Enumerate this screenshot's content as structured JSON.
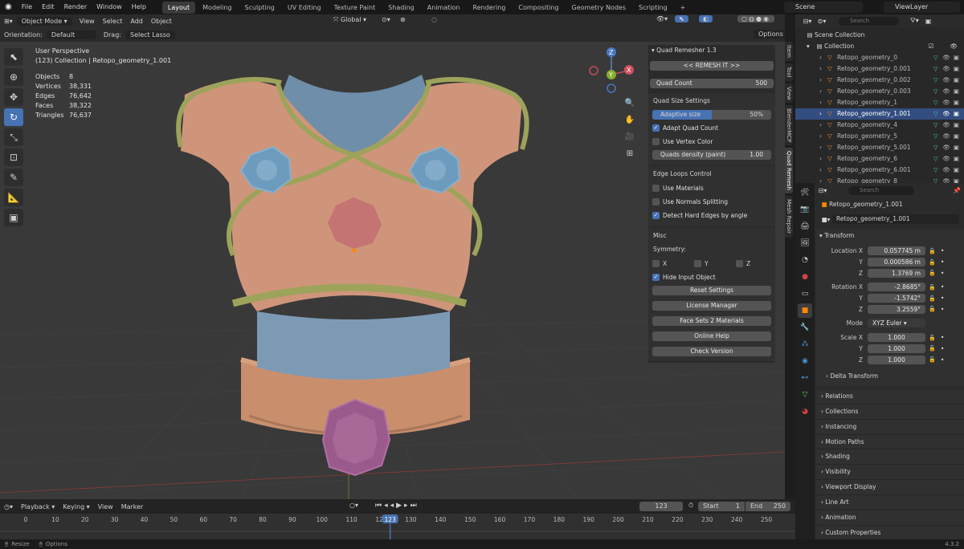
{
  "topbar": {
    "menus": [
      "File",
      "Edit",
      "Render",
      "Window",
      "Help"
    ],
    "workspaces": [
      "Layout",
      "Modeling",
      "Sculpting",
      "UV Editing",
      "Texture Paint",
      "Shading",
      "Animation",
      "Rendering",
      "Compositing",
      "Geometry Nodes",
      "Scripting"
    ],
    "active_workspace": "Layout",
    "add_tab": "+",
    "scene": "Scene",
    "view_layer": "ViewLayer"
  },
  "viewport": {
    "mode": "Object Mode",
    "menus": [
      "View",
      "Select",
      "Add",
      "Object"
    ],
    "orientation_label": "Orientation:",
    "orientation_value": "Default",
    "drag_label": "Drag:",
    "drag_value": "Select Lasso",
    "transform_orientation": "Global",
    "options": "Options",
    "view_name": "User Perspective",
    "collection_line": "(123) Collection | Retopo_geometry_1.001",
    "stats": [
      {
        "k": "Objects",
        "v": "8"
      },
      {
        "k": "Vertices",
        "v": "38,331"
      },
      {
        "k": "Edges",
        "v": "76,642"
      },
      {
        "k": "Faces",
        "v": "38,322"
      },
      {
        "k": "Triangles",
        "v": "76,637"
      }
    ],
    "gizmo": {
      "x": "X",
      "y": "Y",
      "z": "Z"
    }
  },
  "npanel": {
    "title": "Quad Remesher 1.3",
    "remesh_btn": "<<  REMESH IT >>",
    "quad_count_label": "Quad Count",
    "quad_count_value": "500",
    "quad_size_title": "Quad Size Settings",
    "adaptive_label": "Adaptive size",
    "adaptive_value": "50%",
    "adaptive_fill": 0.5,
    "adapt_quad_count": "Adapt Quad Count",
    "use_vertex_color": "Use Vertex Color",
    "quads_density_label": "Quads density (paint)",
    "quads_density_value": "1.00",
    "edge_loops_title": "Edge Loops Control",
    "use_materials": "Use Materials",
    "use_normals": "Use Normals Splitting",
    "detect_hard": "Detect Hard Edges by angle",
    "misc_title": "Misc",
    "symmetry_label": "Symmetry:",
    "sym_x": "X",
    "sym_y": "Y",
    "sym_z": "Z",
    "hide_input": "Hide Input Object",
    "reset_settings": "Reset Settings",
    "license_manager": "License Manager",
    "face_sets": "Face Sets 2 Materials",
    "online_help": "Online Help",
    "check_version": "Check Version"
  },
  "vtabs": [
    "Item",
    "Tool",
    "View",
    "BlenderMCP",
    "Quad Remesh",
    "Mesh Repair"
  ],
  "outliner": {
    "search_placeholder": "Search",
    "scene_collection": "Scene Collection",
    "collection": "Collection",
    "items": [
      "Retopo_geometry_0",
      "Retopo_geometry_0.001",
      "Retopo_geometry_0.002",
      "Retopo_geometry_0.003",
      "Retopo_geometry_1",
      "Retopo_geometry_1.001",
      "Retopo_geometry_4",
      "Retopo_geometry_5",
      "Retopo_geometry_5.001",
      "Retopo_geometry_6",
      "Retopo_geometry_6.001",
      "Retopo_geometry_8"
    ]
  },
  "properties": {
    "search_placeholder": "Search",
    "object_name": "Retopo_geometry_1.001",
    "object_data_name": "Retopo_geometry_1.001",
    "transform": "Transform",
    "location_label": "Location X",
    "loc": [
      "0.057745 m",
      "0.000586 m",
      "1.3769 m"
    ],
    "rotation_label": "Rotation X",
    "rot": [
      "-2.8685°",
      "-1.5742°",
      "3.2559°"
    ],
    "mode_label": "Mode",
    "mode_value": "XYZ Euler",
    "scale_label": "Scale X",
    "scale": [
      "1.000",
      "1.000",
      "1.000"
    ],
    "y": "Y",
    "z": "Z",
    "delta": "Delta Transform",
    "collapsed": [
      "Relations",
      "Collections",
      "Instancing",
      "Motion Paths",
      "Shading",
      "Visibility",
      "Viewport Display",
      "Line Art",
      "Animation",
      "Custom Properties"
    ]
  },
  "timeline": {
    "menus": [
      "Playback",
      "Keying",
      "View",
      "Marker"
    ],
    "current_frame": "123",
    "start_label": "Start",
    "start_value": "1",
    "end_label": "End",
    "end_value": "250",
    "ticks": [
      "0",
      "10",
      "20",
      "30",
      "40",
      "50",
      "60",
      "70",
      "80",
      "90",
      "100",
      "110",
      "120",
      "130",
      "140",
      "150",
      "160",
      "170",
      "180",
      "190",
      "200",
      "210",
      "220",
      "230",
      "240",
      "250"
    ],
    "playhead": "123"
  },
  "status": {
    "resize": "Resize",
    "options": "Options",
    "version": "4.3.2"
  }
}
